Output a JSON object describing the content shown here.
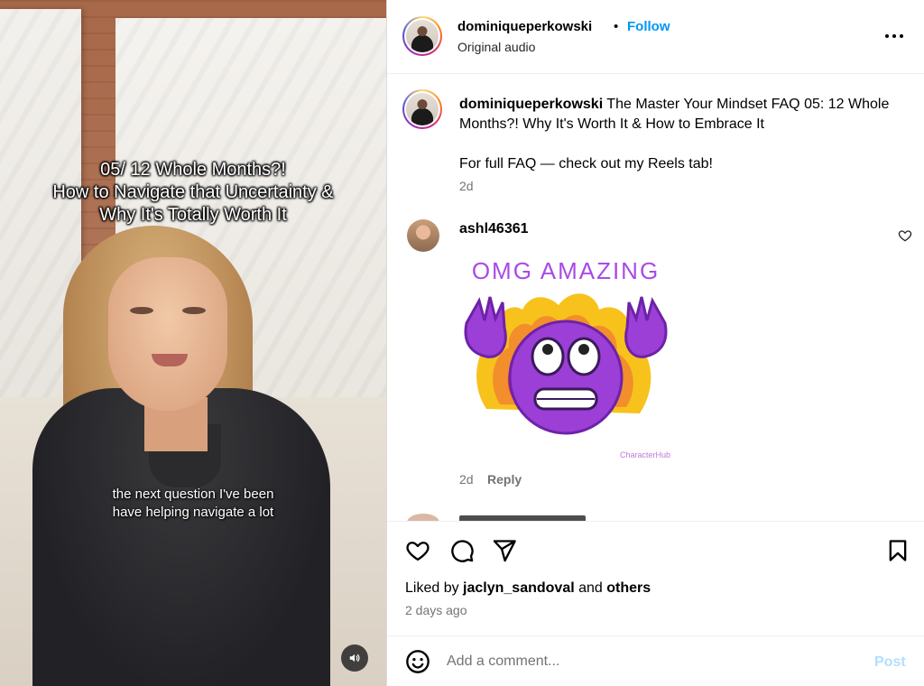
{
  "video": {
    "title_lines": [
      "05/ 12 Whole Months?!",
      "How to Navigate that Uncertainty &",
      "Why It's Totally Worth It"
    ],
    "caption_lines": [
      "the next question I've been",
      "have helping navigate a lot"
    ],
    "mute_icon": "speaker-icon"
  },
  "header": {
    "username": "dominiqueperkowski",
    "separator": "•",
    "follow_label": "Follow",
    "audio": "Original audio",
    "more_icon": "more-horizontal-icon"
  },
  "caption": {
    "username": "dominiqueperkowski",
    "text": "The Master Your Mindset FAQ 05: 12 Whole Months?! Why It's Worth It & How to Embrace It",
    "text2": "For full FAQ — check out my Reels tab!",
    "time": "2d"
  },
  "comment": {
    "username": "ashl46361",
    "gif_text": "OMG AMAZING",
    "gif_credit": "CharacterHub",
    "time": "2d",
    "reply_label": "Reply"
  },
  "actions": {
    "liked_prefix": "Liked by",
    "liked_user": "jaclyn_sandoval",
    "liked_and": "and",
    "liked_others": "others",
    "ago": "2 days ago"
  },
  "composer": {
    "placeholder": "Add a comment...",
    "post_label": "Post"
  },
  "colors": {
    "accent": "#0095f6",
    "post_disabled": "#b2dffc",
    "muted_text": "#737373"
  }
}
